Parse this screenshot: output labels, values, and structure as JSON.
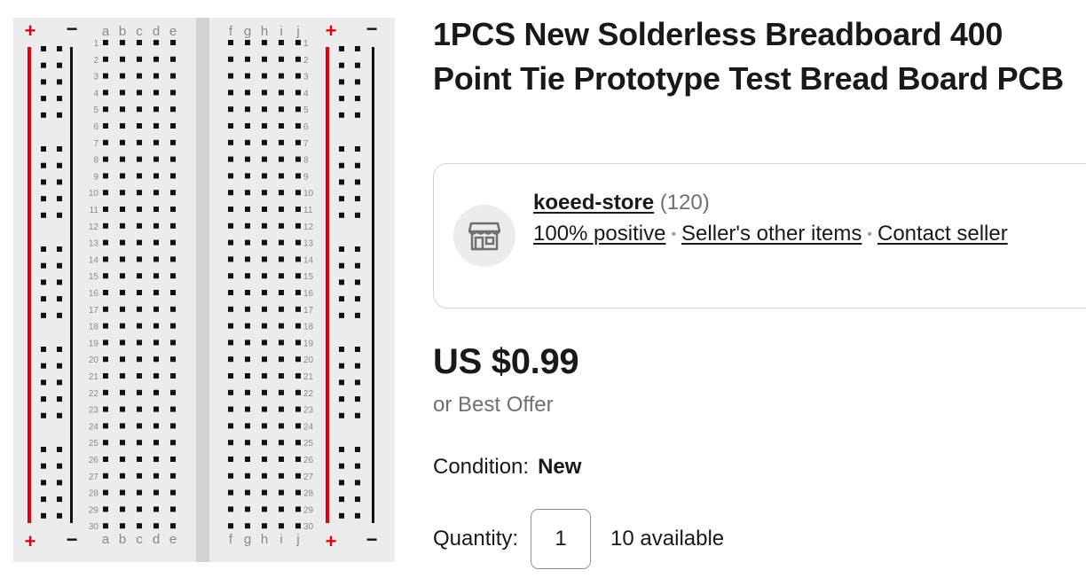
{
  "product": {
    "title": "1PCS New Solderless Breadboard 400 Point Tie Prototype Test Bread Board PCB",
    "image": {
      "icon": "breadboard-photo",
      "columns_left": [
        "a",
        "b",
        "c",
        "d",
        "e"
      ],
      "columns_right": [
        "f",
        "g",
        "h",
        "i",
        "j"
      ],
      "row_count": 30,
      "plus_symbol": "+",
      "minus_symbol": "−",
      "colors": {
        "board": "#ececec",
        "divider": "#d2d2d2",
        "hole": "#111111",
        "positive_rail": "#e3000b",
        "negative_rail": "#111111",
        "label": "#8a8a8a"
      }
    }
  },
  "seller": {
    "avatar_icon": "store-icon",
    "name": "koeed-store",
    "feedback_count": "(120)",
    "positive": "100% positive",
    "other_items": "Seller's other items",
    "contact": "Contact seller"
  },
  "pricing": {
    "price": "US $0.99",
    "best_offer": "or Best Offer"
  },
  "condition": {
    "label": "Condition:",
    "value": "New"
  },
  "quantity": {
    "label": "Quantity:",
    "value": "1",
    "available": "10 available"
  }
}
